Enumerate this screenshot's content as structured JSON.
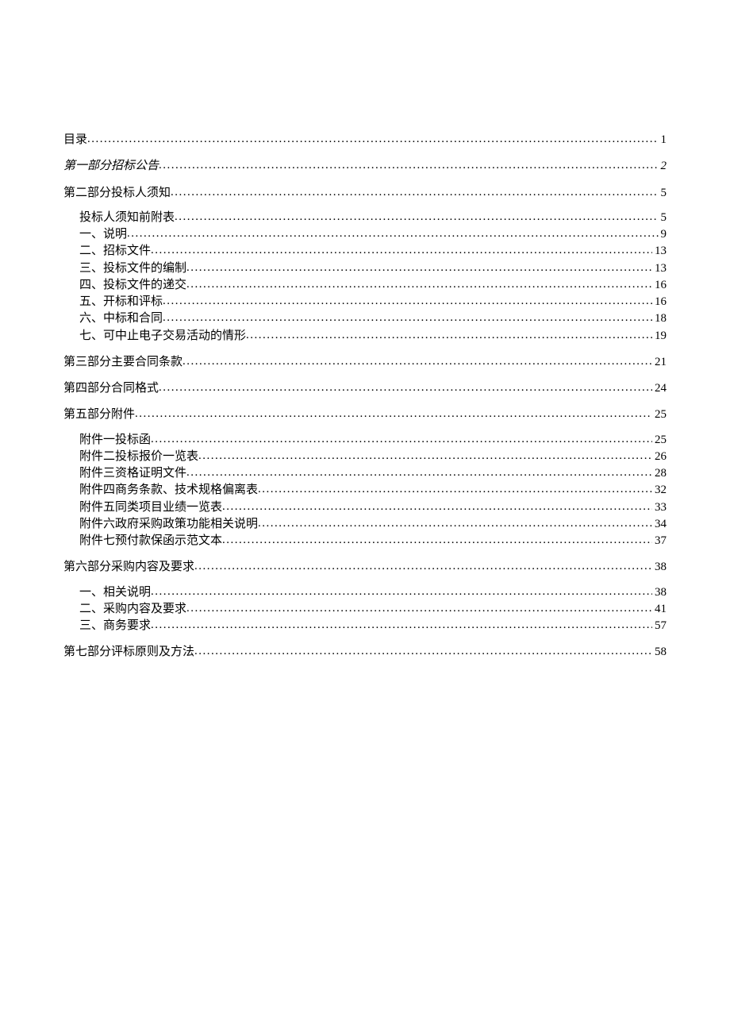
{
  "toc": [
    {
      "level": 0,
      "title": "目录",
      "page": "1",
      "italic": false
    },
    {
      "level": 0,
      "title": "第一部分招标公告",
      "page": "2",
      "italic": true
    },
    {
      "level": 0,
      "title": "第二部分投标人须知",
      "page": "5",
      "italic": false
    },
    {
      "level": 1,
      "title": "投标人须知前附表",
      "page": "5",
      "italic": false
    },
    {
      "level": 1,
      "title": "一、说明",
      "page": "9",
      "italic": false
    },
    {
      "level": 1,
      "title": "二、招标文件",
      "page": "13",
      "italic": false
    },
    {
      "level": 1,
      "title": "三、投标文件的编制",
      "page": "13",
      "italic": false
    },
    {
      "level": 1,
      "title": "四、投标文件的递交",
      "page": "16",
      "italic": false
    },
    {
      "level": 1,
      "title": "五、开标和评标",
      "page": "16",
      "italic": false
    },
    {
      "level": 1,
      "title": "六、中标和合同",
      "page": "18",
      "italic": false
    },
    {
      "level": 1,
      "title": "七、可中止电子交易活动的情形",
      "page": "19",
      "italic": false
    },
    {
      "level": 0,
      "title": "第三部分主要合同条款",
      "page": "21",
      "italic": false
    },
    {
      "level": 0,
      "title": "第四部分合同格式",
      "page": "24",
      "italic": false
    },
    {
      "level": 0,
      "title": "第五部分附件",
      "page": "25",
      "italic": false
    },
    {
      "level": 1,
      "title": "附件一投标函",
      "page": "25",
      "italic": false
    },
    {
      "level": 1,
      "title": "附件二投标报价一览表",
      "page": "26",
      "italic": false
    },
    {
      "level": 1,
      "title": "附件三资格证明文件",
      "page": "28",
      "italic": false
    },
    {
      "level": 1,
      "title": "附件四商务条款、技术规格偏离表",
      "page": "32",
      "italic": false
    },
    {
      "level": 1,
      "title": "附件五同类项目业绩一览表",
      "page": "33",
      "italic": false
    },
    {
      "level": 1,
      "title": "附件六政府采购政策功能相关说明",
      "page": "34",
      "italic": false
    },
    {
      "level": 1,
      "title": "附件七预付款保函示范文本",
      "page": "37",
      "italic": false
    },
    {
      "level": 0,
      "title": "第六部分采购内容及要求",
      "page": "38",
      "italic": false
    },
    {
      "level": 1,
      "title": "一、相关说明",
      "page": "38",
      "italic": false
    },
    {
      "level": 1,
      "title": "二、采购内容及要求",
      "page": "41",
      "italic": false
    },
    {
      "level": 1,
      "title": "三、商务要求",
      "page": "57",
      "italic": false
    },
    {
      "level": 0,
      "title": "第七部分评标原则及方法",
      "page": "58",
      "italic": false
    }
  ]
}
